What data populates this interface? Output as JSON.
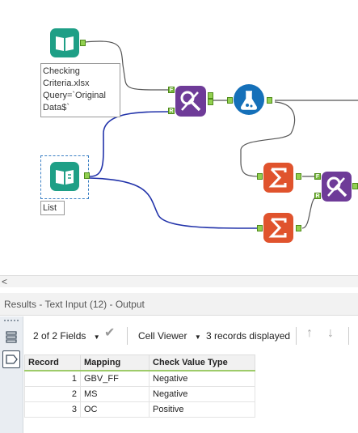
{
  "canvas": {
    "annotations": {
      "checking_input": [
        "Checking",
        "Criteria.xlsx",
        "Query=`Original",
        "Data$`"
      ],
      "list_input": [
        "List"
      ]
    },
    "anchors": {
      "f": "F",
      "r": "R"
    },
    "colors": {
      "input": "#1e9f86",
      "join": "#6e3b98",
      "formula": "#1570b9",
      "summarize": "#e0532d",
      "wire": "#2233aa",
      "wire_gray": "#555555"
    }
  },
  "scroll": {
    "left_arrow": "<"
  },
  "results": {
    "title": "Results - Text Input (12) - Output",
    "toolbar": {
      "fields": "2 of 2 Fields",
      "cell_viewer": "Cell Viewer",
      "records": "3 records displayed"
    },
    "table": {
      "headers": [
        "Record",
        "Mapping",
        "Check Value Type"
      ],
      "rows": [
        [
          "1",
          "GBV_FF",
          "Negative"
        ],
        [
          "2",
          "MS",
          "Negative"
        ],
        [
          "3",
          "OC",
          "Positive"
        ]
      ]
    }
  }
}
